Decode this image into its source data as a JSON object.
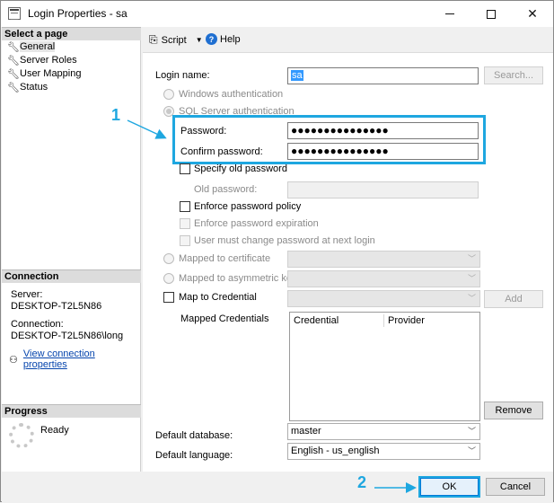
{
  "window": {
    "title": "Login Properties - sa",
    "accent_color": "#1ea7e0",
    "controls": [
      "minimize-icon",
      "maximize-icon",
      "close-icon"
    ]
  },
  "left_pane": {
    "select_page_header": "Select a page",
    "pages": [
      {
        "label": "General",
        "icon": "wrench-icon",
        "selected": true
      },
      {
        "label": "Server Roles",
        "icon": "wrench-icon",
        "selected": false
      },
      {
        "label": "User Mapping",
        "icon": "wrench-icon",
        "selected": false
      },
      {
        "label": "Status",
        "icon": "wrench-icon",
        "selected": false
      }
    ],
    "connection_header": "Connection",
    "server_label": "Server:",
    "server_value": "DESKTOP-T2L5N86",
    "connection_label": "Connection:",
    "connection_value": "DESKTOP-T2L5N86\\long",
    "view_connection_link": "View connection properties",
    "progress_header": "Progress",
    "progress_status": "Ready"
  },
  "toolbar": {
    "script_label": "Script",
    "help_label": "Help"
  },
  "general": {
    "login_name_label": "Login name:",
    "login_name_value": "sa",
    "search_button": "Search...",
    "windows_auth_label": "Windows authentication",
    "sql_auth_label": "SQL Server authentication",
    "password_label": "Password:",
    "password_value": "●●●●●●●●●●●●●●●",
    "confirm_password_label": "Confirm password:",
    "confirm_password_value": "●●●●●●●●●●●●●●●",
    "specify_old_password_label": "Specify old password",
    "old_password_label": "Old password:",
    "enforce_policy_label": "Enforce password policy",
    "enforce_expiration_label": "Enforce password expiration",
    "must_change_label": "User must change password at next login",
    "mapped_certificate_label": "Mapped to certificate",
    "mapped_asym_key_label": "Mapped to asymmetric key",
    "map_credential_label": "Map to Credential",
    "add_button": "Add",
    "mapped_credentials_label": "Mapped Credentials",
    "credentials_columns": [
      "Credential",
      "Provider"
    ],
    "remove_button": "Remove",
    "default_database_label": "Default database:",
    "default_database_value": "master",
    "default_language_label": "Default language:",
    "default_language_value": "English - us_english"
  },
  "footer": {
    "ok_button": "OK",
    "cancel_button": "Cancel"
  },
  "annotations": {
    "callout_1": "1",
    "callout_2": "2"
  }
}
